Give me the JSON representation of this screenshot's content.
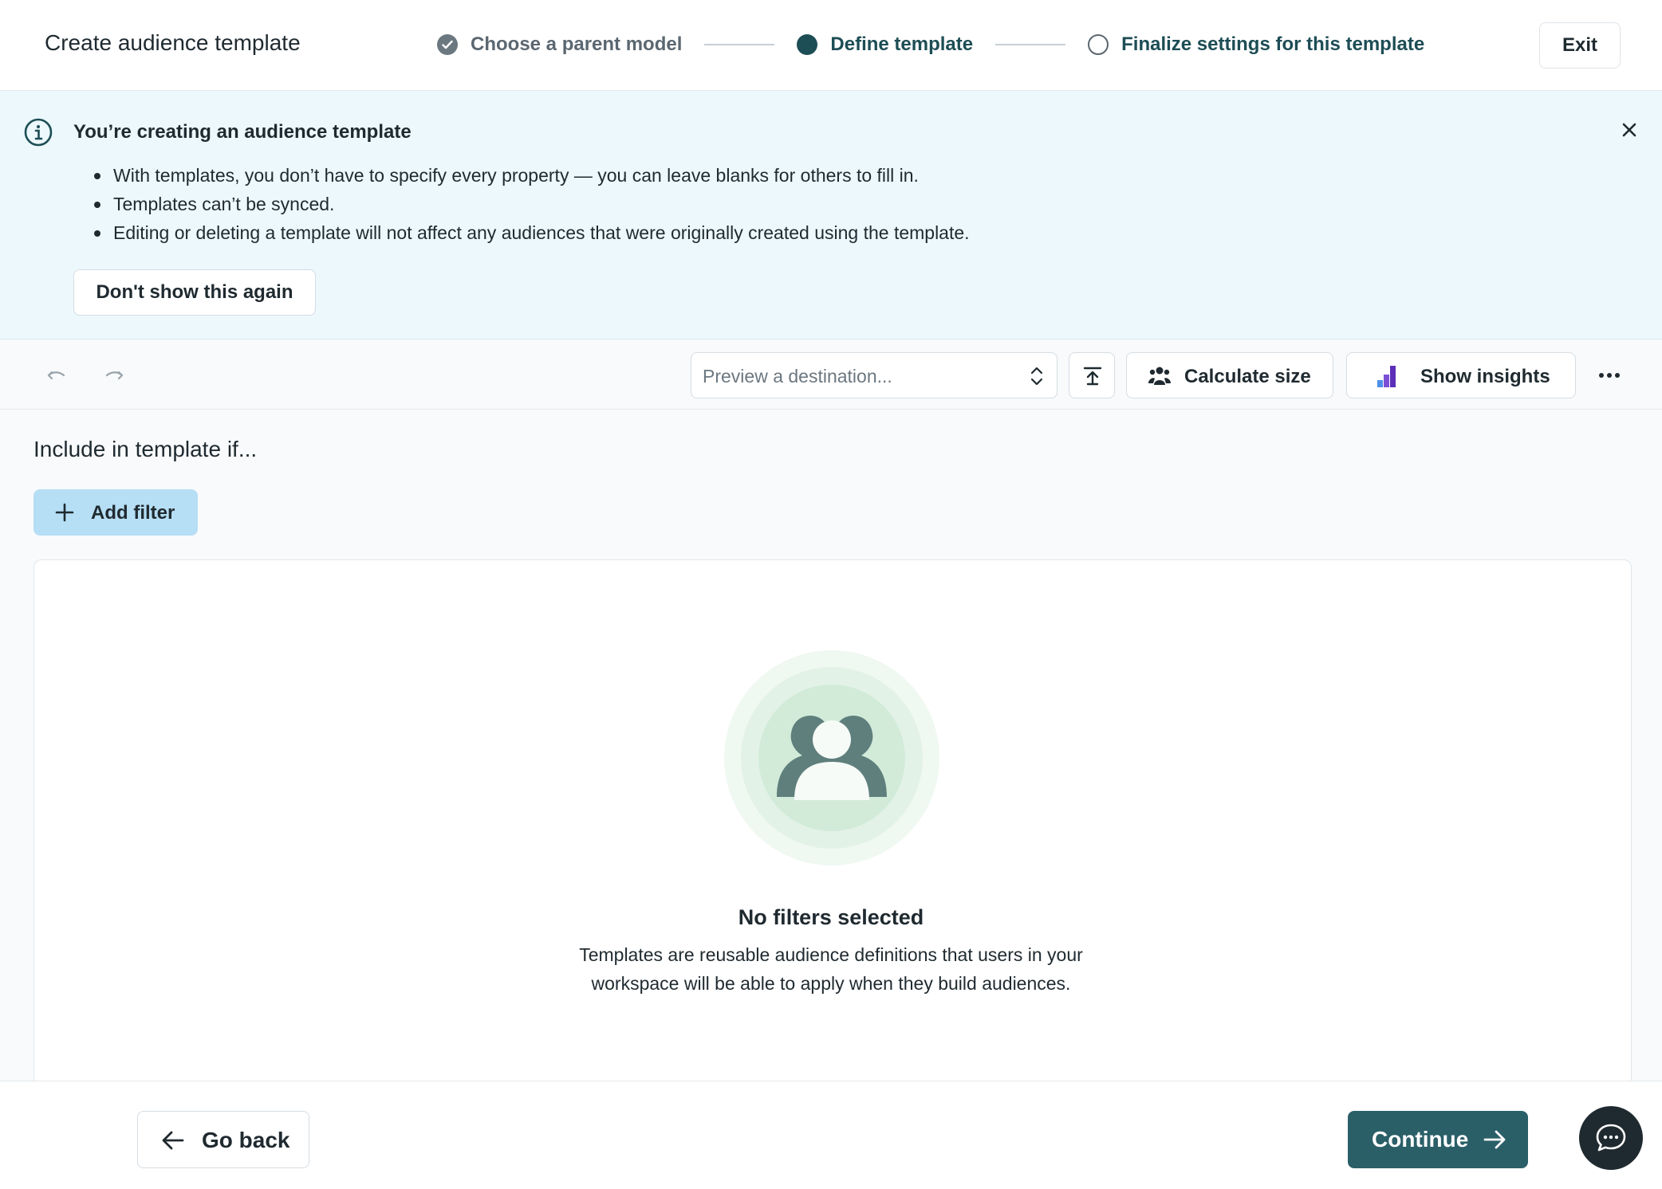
{
  "header": {
    "title": "Create audience template",
    "steps": [
      {
        "label": "Choose a parent model",
        "state": "completed"
      },
      {
        "label": "Define template",
        "state": "active"
      },
      {
        "label": "Finalize settings for this template",
        "state": "upcoming"
      }
    ],
    "exit_label": "Exit"
  },
  "banner": {
    "title": "You’re creating an audience template",
    "bullets": [
      "With templates, you don’t have to specify every property — you can leave blanks for others to fill in.",
      "Templates can’t be synced.",
      "Editing or deleting a template will not affect any audiences that were originally created using the template."
    ],
    "dismiss_label": "Don't show this again",
    "icon": "info-icon"
  },
  "toolbar": {
    "destination_placeholder": "Preview a destination...",
    "calculate_label": "Calculate size",
    "insights_label": "Show insights",
    "icons": [
      "undo-icon",
      "redo-icon",
      "upload-icon",
      "people-icon",
      "bar-chart-icon",
      "more-icon"
    ]
  },
  "main": {
    "section_title": "Include in template if...",
    "add_filter_label": "Add filter",
    "empty_title": "No filters selected",
    "empty_desc_line1": "Templates are reusable audience definitions that users in your",
    "empty_desc_line2": "workspace will be able to apply when they build audiences."
  },
  "footer": {
    "back_label": "Go back",
    "continue_label": "Continue"
  },
  "colors": {
    "primary": "#2a5f68",
    "banner_bg": "#ecf8fc",
    "accent_button": "#b6def5",
    "step_active": "#1d4d55"
  }
}
